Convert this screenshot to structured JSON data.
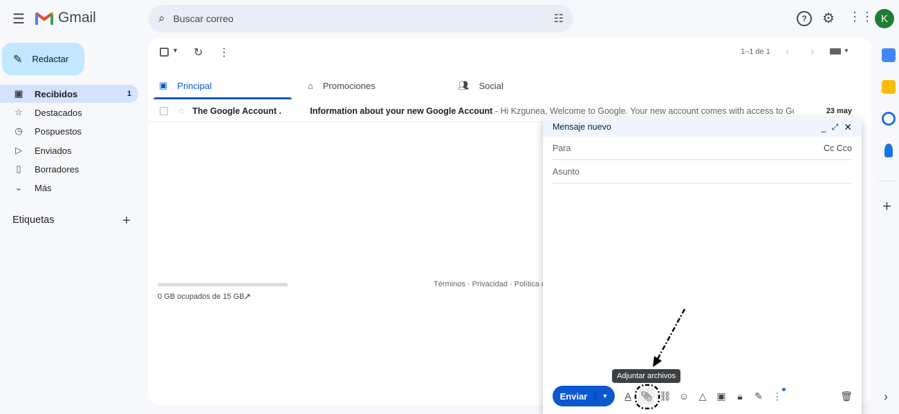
{
  "app": {
    "name": "Gmail"
  },
  "search": {
    "placeholder": "Buscar correo"
  },
  "user": {
    "avatar_letter": "K",
    "avatar_color": "#1e7e34"
  },
  "compose_button": "Redactar",
  "sidebar": {
    "items": [
      {
        "label": "Recibidos",
        "count": "1",
        "icon": "inbox-icon",
        "active": true
      },
      {
        "label": "Destacados",
        "icon": "star-icon"
      },
      {
        "label": "Pospuestos",
        "icon": "clock-icon"
      },
      {
        "label": "Enviados",
        "icon": "send-icon"
      },
      {
        "label": "Borradores",
        "icon": "draft-icon"
      },
      {
        "label": "Más",
        "icon": "chevron-down-icon"
      }
    ],
    "labels_title": "Etiquetas"
  },
  "toolbar": {
    "pagination": "1–1 de 1"
  },
  "tabs": [
    {
      "label": "Principal",
      "active": true
    },
    {
      "label": "Promociones"
    },
    {
      "label": "Social"
    }
  ],
  "emails": [
    {
      "sender": "The Google Account .",
      "subject": "Information about your new Google Account",
      "snippet": " - Hi Kzgunea, Welcome to Google. Your new account comes with access to Goo...",
      "date": "23 may"
    }
  ],
  "footer": {
    "storage": "0 GB ocupados de 15 GB",
    "storage_used_fraction": 0,
    "links": "Términos · Privacidad · Política del"
  },
  "compose": {
    "title": "Mensaje nuevo",
    "to_label": "Para",
    "cc_bcc": "Cc Cco",
    "subject_label": "Asunto",
    "send_label": "Enviar",
    "tooltip": "Adjuntar archivos"
  },
  "colors": {
    "accent": "#0b57d0",
    "active_nav": "#d3e3fd",
    "compose_btn": "#c2e7ff"
  }
}
